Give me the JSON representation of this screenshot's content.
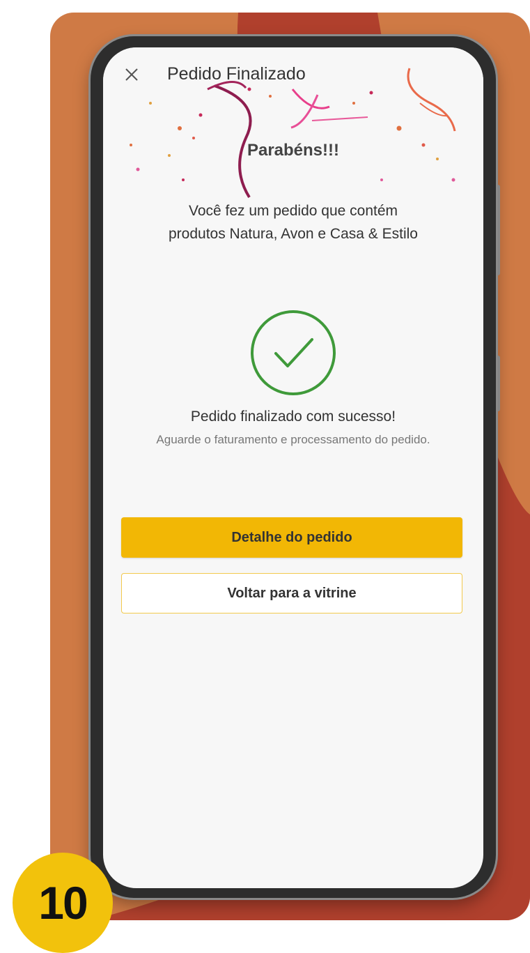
{
  "appbar": {
    "close_icon": "close-icon",
    "title": "Pedido Finalizado"
  },
  "celebration": {
    "headline": "Parabéns!!!",
    "message_line1": "Você fez um pedido que contém",
    "message_line2": "produtos Natura, Avon e Casa & Estilo"
  },
  "status": {
    "icon": "check-circle-icon",
    "title": "Pedido finalizado com sucesso!",
    "subtitle": "Aguarde o faturamento e processamento do pedido."
  },
  "actions": {
    "primary_label": "Detalhe do pedido",
    "secondary_label": "Voltar para a vitrine"
  },
  "step_badge": "10",
  "colors": {
    "accent": "#f2b705",
    "success": "#3f9a3a",
    "background": "#cf7a45",
    "background_dark": "#b0402d"
  }
}
